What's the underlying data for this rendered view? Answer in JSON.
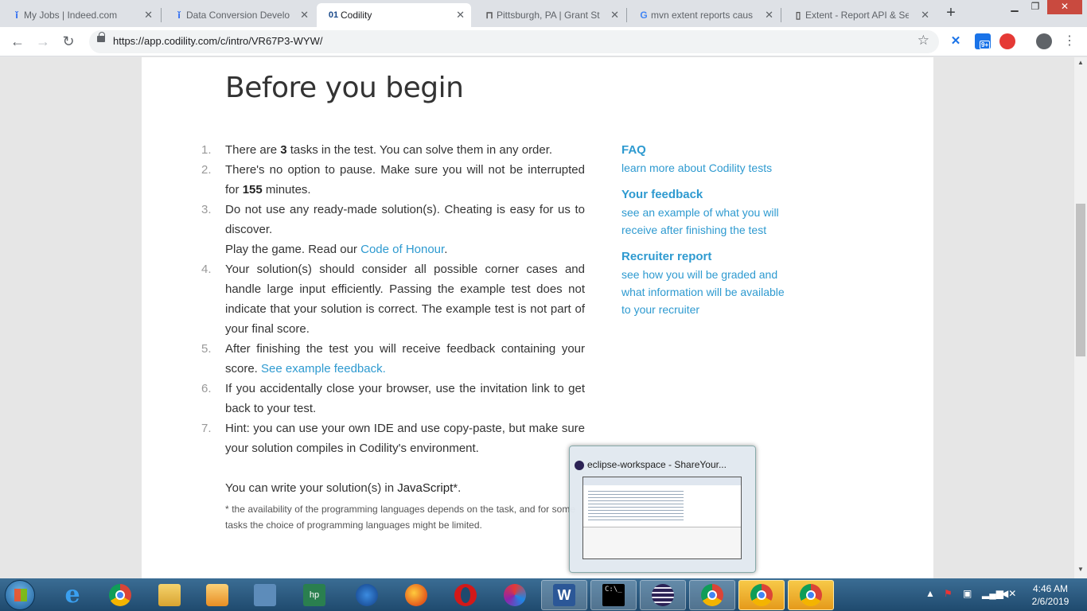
{
  "browser": {
    "tabs": [
      {
        "title": "My Jobs | Indeed.com",
        "icon": "indeed-icon"
      },
      {
        "title": "Data Conversion Develo",
        "icon": "indeed-icon"
      },
      {
        "title": "Codility",
        "icon": "codility-icon",
        "active": true
      },
      {
        "title": "Pittsburgh, PA | Grant St",
        "icon": "building-icon"
      },
      {
        "title": "mvn extent reports caus",
        "icon": "google-icon"
      },
      {
        "title": "Extent - Report API & Se",
        "icon": "document-icon"
      }
    ],
    "url": "https://app.codility.com/c/intro/VR67P3-WYW/",
    "ext_badge": "9+"
  },
  "page": {
    "title": "Before you begin",
    "steps": [
      {
        "num": "1.",
        "pre": "There are ",
        "bold": "3",
        "post": " tasks in the test. You can solve them in any order."
      },
      {
        "num": "2.",
        "pre": "There's no option to pause. Make sure you will not be interrupted for ",
        "bold": "155",
        "post": " minutes."
      },
      {
        "num": "3.",
        "text": "Do not use any ready-made solution(s). Cheating is easy for us to discover.",
        "text2": "Play the game. Read our ",
        "link": "Code of Honour",
        "post": "."
      },
      {
        "num": "4.",
        "text": "Your solution(s) should consider all possible corner cases and handle large input efficiently. Passing the example test does not indicate that your solution is correct. The example test is not part of your final score."
      },
      {
        "num": "5.",
        "text": "After finishing the test you will receive feedback containing your score. ",
        "link": "See example feedback."
      },
      {
        "num": "6.",
        "text": "If you accidentally close your browser, use the invitation link to get back to your test."
      },
      {
        "num": "7.",
        "text": "Hint: you can use your own IDE and use copy-paste, but make sure your solution compiles in Codility's environment."
      }
    ],
    "lang_prefix": "You can write your solution(s) in ",
    "lang_name": "JavaScript",
    "lang_suffix": "*.",
    "note": "* the availability of the programming languages depends on the task, and for some tasks the choice of programming languages might be limited.",
    "sidebar": [
      {
        "heading": "FAQ",
        "desc": "learn more about Codility tests"
      },
      {
        "heading": "Your feedback",
        "desc": "see an example of what you will receive after finishing the test"
      },
      {
        "heading": "Recruiter report",
        "desc": "see how you will be graded and what information will be available to your recruiter"
      }
    ]
  },
  "preview": {
    "title": "eclipse-workspace - ShareYour..."
  },
  "taskbar": {
    "hp_label": "hp",
    "word_label": "W",
    "cmd_label": "C:\\_",
    "time": "4:46 AM",
    "date": "2/6/2019"
  },
  "colors": {
    "link": "#2e9ad0",
    "accent_tab": "#ffffff"
  }
}
